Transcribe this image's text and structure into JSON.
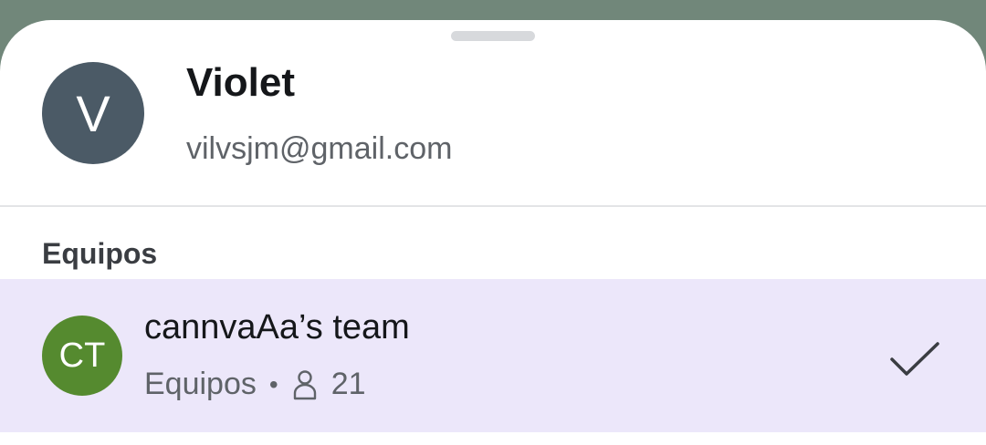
{
  "account": {
    "avatar_initial": "V",
    "name": "Violet",
    "email": "vilvsjm@gmail.com"
  },
  "teams_section": {
    "title": "Equipos",
    "items": [
      {
        "initials": "CT",
        "name": "cannvaAa’s team",
        "type": "Equipos",
        "separator": "•",
        "member_count": "21",
        "selected": true,
        "avatar_color": "#558a2f"
      }
    ]
  },
  "colors": {
    "sheet_background": "#ffffff",
    "backdrop": "#71877a",
    "selected_row": "#ece7fa",
    "user_avatar": "#4b5a66"
  },
  "icons": [
    "person-icon",
    "checkmark-icon"
  ]
}
